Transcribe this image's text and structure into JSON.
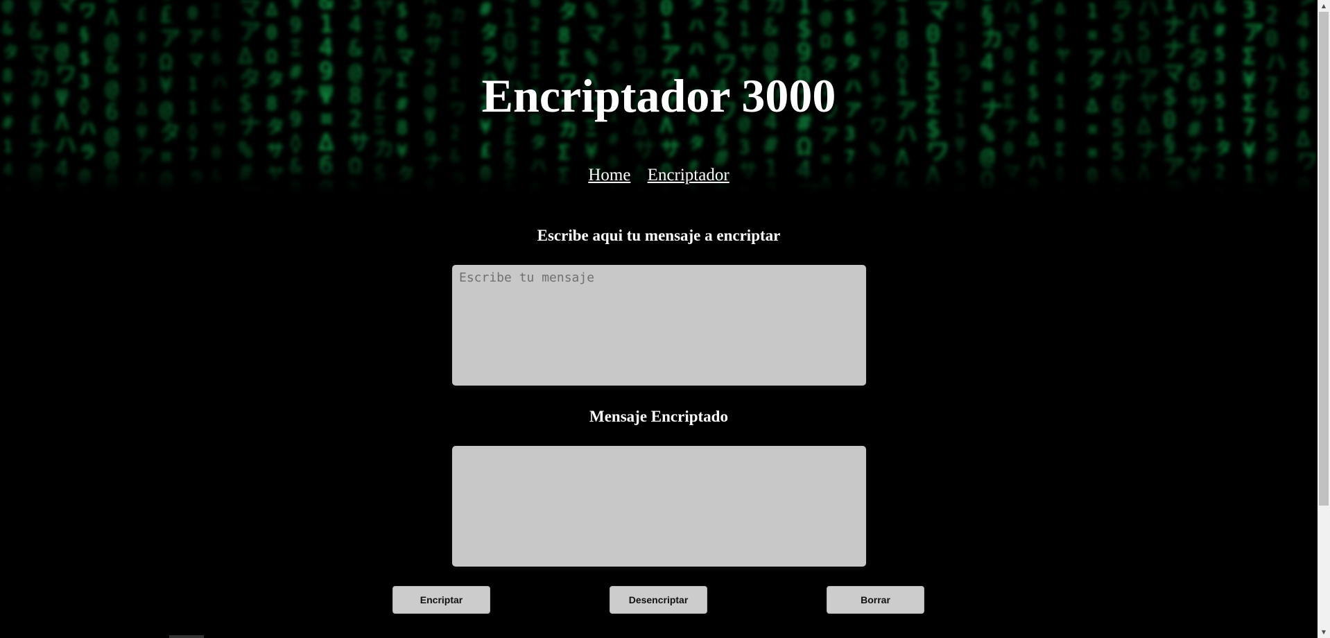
{
  "header": {
    "title": "Encriptador 3000",
    "background_accent": "#16c45a",
    "nav": [
      {
        "label": "Home"
      },
      {
        "label": "Encriptador"
      }
    ]
  },
  "main": {
    "input_heading": "Escribe aqui tu mensaje a encriptar",
    "input_placeholder": "Escribe tu mensaje",
    "input_value": "",
    "output_heading": "Mensaje Encriptado",
    "output_value": "",
    "buttons": {
      "encrypt": "Encriptar",
      "decrypt": "Desencriptar",
      "clear": "Borrar"
    }
  },
  "colors": {
    "page_background": "#000000",
    "textbox_background": "#c8c8c8",
    "button_background": "#cccccc"
  },
  "scrollbar": {
    "up_icon": "triangle-up-icon",
    "down_icon": "triangle-down-icon"
  }
}
